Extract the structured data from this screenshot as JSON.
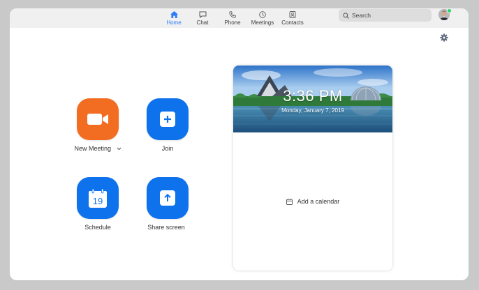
{
  "nav": {
    "items": [
      {
        "label": "Home",
        "icon": "home-icon",
        "active": true
      },
      {
        "label": "Chat",
        "icon": "chat-icon"
      },
      {
        "label": "Phone",
        "icon": "phone-icon"
      },
      {
        "label": "Meetings",
        "icon": "clock-icon"
      },
      {
        "label": "Contacts",
        "icon": "contacts-icon"
      }
    ]
  },
  "search": {
    "placeholder": "Search",
    "icon": "search-icon"
  },
  "actions": {
    "new_meeting": {
      "label": "New Meeting",
      "icon": "video-camera-icon",
      "color": "#f26d21"
    },
    "join": {
      "label": "Join",
      "icon": "plus-icon",
      "color": "#0e72ed"
    },
    "schedule": {
      "label": "Schedule",
      "icon": "calendar-icon",
      "day": "19",
      "color": "#0e72ed"
    },
    "share_screen": {
      "label": "Share screen",
      "icon": "upload-arrow-icon",
      "color": "#0e72ed"
    }
  },
  "calendar_card": {
    "time": "3:36 PM",
    "date": "Monday, January 7, 2019",
    "add_calendar": "Add a calendar"
  },
  "colors": {
    "accent": "#2d7cf6",
    "online": "#2bd36c"
  }
}
